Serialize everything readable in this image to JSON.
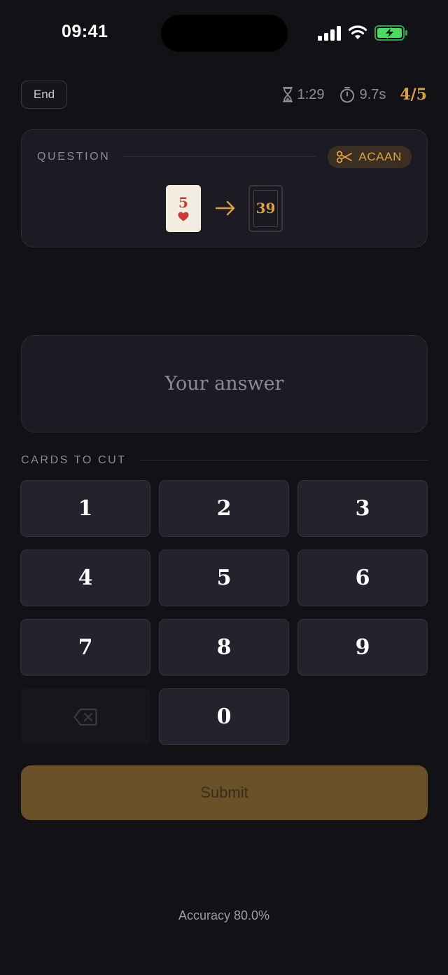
{
  "status_bar": {
    "time": "09:41",
    "icons": [
      "cellular-signal-icon",
      "wifi-icon",
      "battery-charging-icon"
    ]
  },
  "header": {
    "end_label": "End",
    "time_remaining": "1:29",
    "avg_time": "9.7s",
    "progress": "4/5"
  },
  "question": {
    "label": "QUESTION",
    "mode_label": "ACAAN",
    "card": {
      "rank": "5",
      "suit": "hearts"
    },
    "target_position": "39"
  },
  "answer": {
    "placeholder": "Your answer"
  },
  "keypad": {
    "label": "CARDS TO CUT",
    "keys": [
      "1",
      "2",
      "3",
      "4",
      "5",
      "6",
      "7",
      "8",
      "9",
      "0"
    ]
  },
  "submit_label": "Submit",
  "accuracy": "Accuracy 80.0%",
  "colors": {
    "background": "#121116",
    "accent": "#d8a24a",
    "card_red": "#c83a36",
    "submit_disabled": "#6a5129"
  }
}
